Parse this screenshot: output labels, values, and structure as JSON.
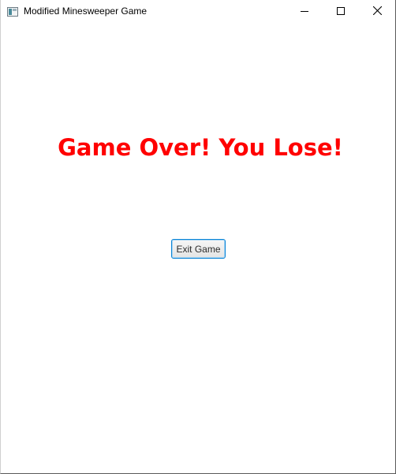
{
  "window": {
    "title": "Modified Minesweeper Game",
    "icon": "java-app-icon",
    "controls": {
      "minimize": "minimize-icon",
      "maximize": "maximize-icon",
      "close": "close-icon"
    }
  },
  "main": {
    "message": "Game Over! You Lose!",
    "message_color": "#ff0000",
    "exit_button_label": "Exit Game",
    "exit_button_border": "#0a84d6"
  }
}
